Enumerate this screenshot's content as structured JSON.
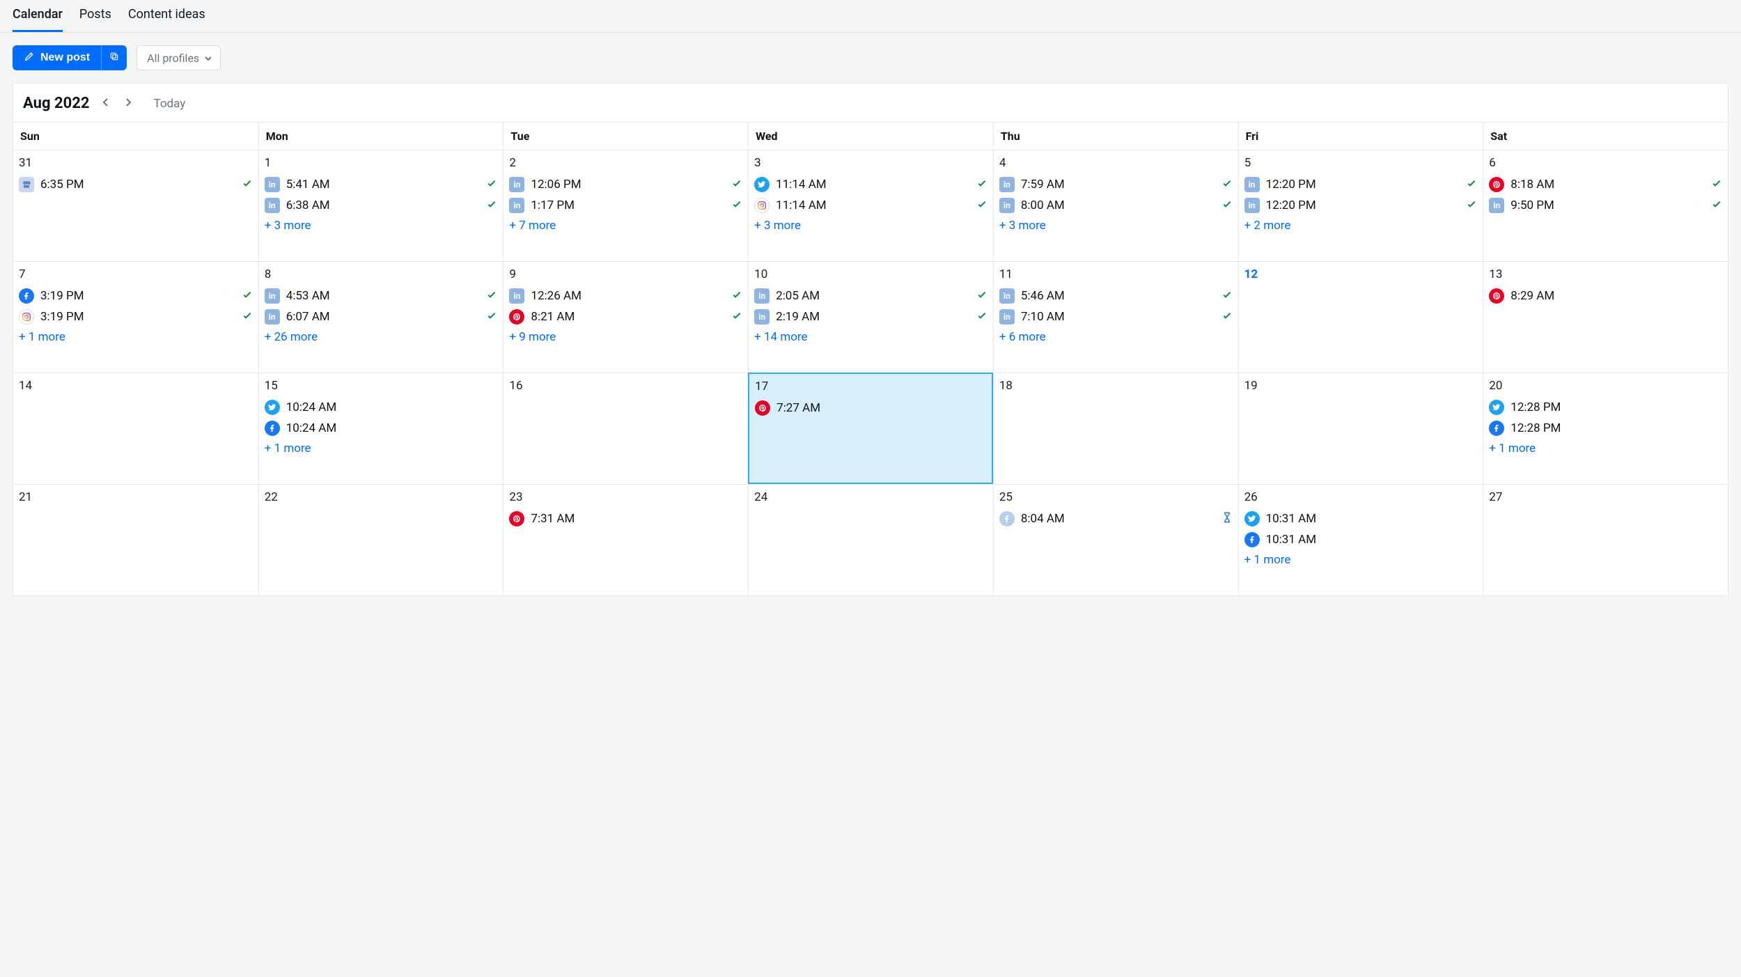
{
  "tabs": {
    "calendar": "Calendar",
    "posts": "Posts",
    "content_ideas": "Content ideas"
  },
  "toolbar": {
    "new_post": "New post",
    "profile_filter": "All profiles"
  },
  "header": {
    "month_label": "Aug 2022",
    "today_label": "Today"
  },
  "day_names": [
    "Sun",
    "Mon",
    "Tue",
    "Wed",
    "Thu",
    "Fri",
    "Sat"
  ],
  "weeks": [
    [
      {
        "num": "31",
        "events": [
          {
            "net": "gmb",
            "time": "6:35 PM",
            "status": "check"
          }
        ]
      },
      {
        "num": "1",
        "events": [
          {
            "net": "linkedin",
            "time": "5:41 AM",
            "status": "check"
          },
          {
            "net": "linkedin",
            "time": "6:38 AM",
            "status": "check"
          }
        ],
        "more": "+ 3 more"
      },
      {
        "num": "2",
        "events": [
          {
            "net": "linkedin",
            "time": "12:06 PM",
            "status": "check"
          },
          {
            "net": "linkedin",
            "time": "1:17 PM",
            "status": "check"
          }
        ],
        "more": "+ 7 more"
      },
      {
        "num": "3",
        "events": [
          {
            "net": "twitter",
            "time": "11:14 AM",
            "status": "check"
          },
          {
            "net": "instagram",
            "time": "11:14 AM",
            "status": "check"
          }
        ],
        "more": "+ 3 more"
      },
      {
        "num": "4",
        "events": [
          {
            "net": "linkedin",
            "time": "7:59 AM",
            "status": "check"
          },
          {
            "net": "linkedin",
            "time": "8:00 AM",
            "status": "check"
          }
        ],
        "more": "+ 3 more"
      },
      {
        "num": "5",
        "events": [
          {
            "net": "linkedin",
            "time": "12:20 PM",
            "status": "check"
          },
          {
            "net": "linkedin",
            "time": "12:20 PM",
            "status": "check"
          }
        ],
        "more": "+ 2 more"
      },
      {
        "num": "6",
        "events": [
          {
            "net": "pinterest",
            "time": "8:18 AM",
            "status": "check"
          },
          {
            "net": "linkedin",
            "time": "9:50 PM",
            "status": "check"
          }
        ]
      }
    ],
    [
      {
        "num": "7",
        "events": [
          {
            "net": "facebook",
            "time": "3:19 PM",
            "status": "check"
          },
          {
            "net": "instagram",
            "time": "3:19 PM",
            "status": "check"
          }
        ],
        "more": "+ 1 more"
      },
      {
        "num": "8",
        "events": [
          {
            "net": "linkedin",
            "time": "4:53 AM",
            "status": "check"
          },
          {
            "net": "linkedin",
            "time": "6:07 AM",
            "status": "check"
          }
        ],
        "more": "+ 26 more"
      },
      {
        "num": "9",
        "events": [
          {
            "net": "linkedin",
            "time": "12:26 AM",
            "status": "check"
          },
          {
            "net": "pinterest",
            "time": "8:21 AM",
            "status": "check"
          }
        ],
        "more": "+ 9 more"
      },
      {
        "num": "10",
        "events": [
          {
            "net": "linkedin",
            "time": "2:05 AM",
            "status": "check"
          },
          {
            "net": "linkedin",
            "time": "2:19 AM",
            "status": "check"
          }
        ],
        "more": "+ 14 more"
      },
      {
        "num": "11",
        "events": [
          {
            "net": "linkedin",
            "time": "5:46 AM",
            "status": "check"
          },
          {
            "net": "linkedin",
            "time": "7:10 AM",
            "status": "check"
          }
        ],
        "more": "+ 6 more"
      },
      {
        "num": "12",
        "today": true,
        "events": []
      },
      {
        "num": "13",
        "events": [
          {
            "net": "pinterest",
            "time": "8:29 AM"
          }
        ]
      }
    ],
    [
      {
        "num": "14",
        "events": []
      },
      {
        "num": "15",
        "events": [
          {
            "net": "twitter",
            "time": "10:24 AM"
          },
          {
            "net": "facebook",
            "time": "10:24 AM"
          }
        ],
        "more": "+ 1 more"
      },
      {
        "num": "16",
        "events": []
      },
      {
        "num": "17",
        "highlight": true,
        "events": [
          {
            "net": "pinterest",
            "time": "7:27 AM"
          }
        ]
      },
      {
        "num": "18",
        "events": []
      },
      {
        "num": "19",
        "events": []
      },
      {
        "num": "20",
        "events": [
          {
            "net": "twitter",
            "time": "12:28 PM"
          },
          {
            "net": "facebook",
            "time": "12:28 PM"
          }
        ],
        "more": "+ 1 more"
      }
    ],
    [
      {
        "num": "21",
        "events": []
      },
      {
        "num": "22",
        "events": []
      },
      {
        "num": "23",
        "events": [
          {
            "net": "pinterest",
            "time": "7:31 AM"
          }
        ]
      },
      {
        "num": "24",
        "events": []
      },
      {
        "num": "25",
        "events": [
          {
            "net": "facebook-fade",
            "time": "8:04 AM",
            "status": "hourglass"
          }
        ]
      },
      {
        "num": "26",
        "events": [
          {
            "net": "twitter",
            "time": "10:31 AM"
          },
          {
            "net": "facebook",
            "time": "10:31 AM"
          }
        ],
        "more": "+ 1 more"
      },
      {
        "num": "27",
        "events": []
      }
    ]
  ]
}
